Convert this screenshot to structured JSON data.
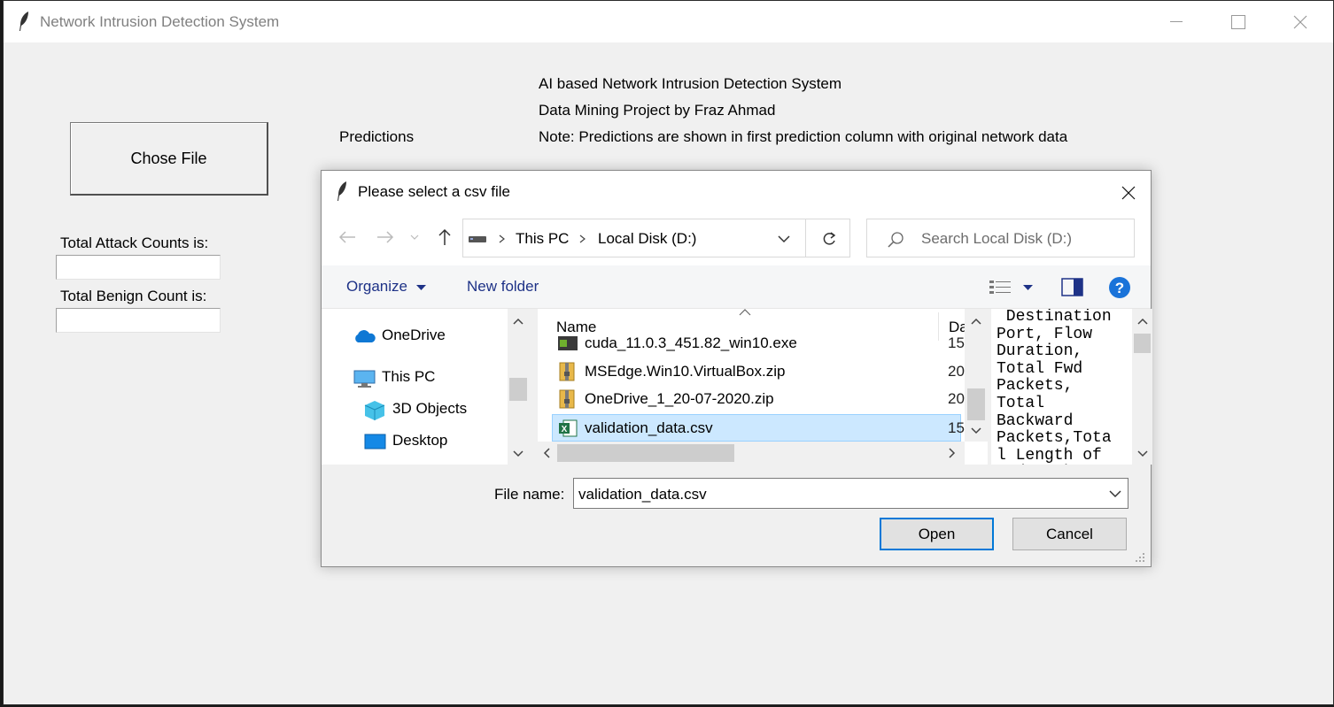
{
  "window": {
    "title": "Network Intrusion Detection System"
  },
  "app": {
    "chose_file_label": "Chose File",
    "predictions_label": "Predictions",
    "header_line1": "AI based Network Intrusion Detection System",
    "header_line2": "Data Mining Project by Fraz Ahmad",
    "header_note": "Note: Predictions are shown in first prediction column with original network data",
    "attack_label": "Total Attack Counts is:",
    "attack_value": "",
    "benign_label": "Total Benign Count is:",
    "benign_value": ""
  },
  "dialog": {
    "title": "Please select a csv file",
    "breadcrumb": [
      "This PC",
      "Local Disk (D:)"
    ],
    "search_placeholder": "Search Local Disk (D:)",
    "organize_label": "Organize",
    "new_folder_label": "New folder",
    "nav_items": [
      "OneDrive",
      "This PC",
      "3D Objects",
      "Desktop"
    ],
    "columns": {
      "name": "Name",
      "date": "Da"
    },
    "files": [
      {
        "name": "cuda_11.0.3_451.82_win10.exe",
        "date": "15"
      },
      {
        "name": "MSEdge.Win10.VirtualBox.zip",
        "date": "20"
      },
      {
        "name": "OneDrive_1_20-07-2020.zip",
        "date": "20"
      },
      {
        "name": "validation_data.csv",
        "date": "15",
        "selected": true
      }
    ],
    "preview_text": " Destination\nPort, Flow\nDuration,\nTotal Fwd\nPackets,\nTotal\nBackward\nPackets,Tota\nl Length of\nFwd Packets",
    "file_name_label": "File name:",
    "file_name_value": "validation_data.csv",
    "open_label": "Open",
    "cancel_label": "Cancel"
  },
  "colors": {
    "selection": "#cce8ff",
    "accent": "#0078d7",
    "link": "#1e3287",
    "help": "#1a73d9"
  }
}
